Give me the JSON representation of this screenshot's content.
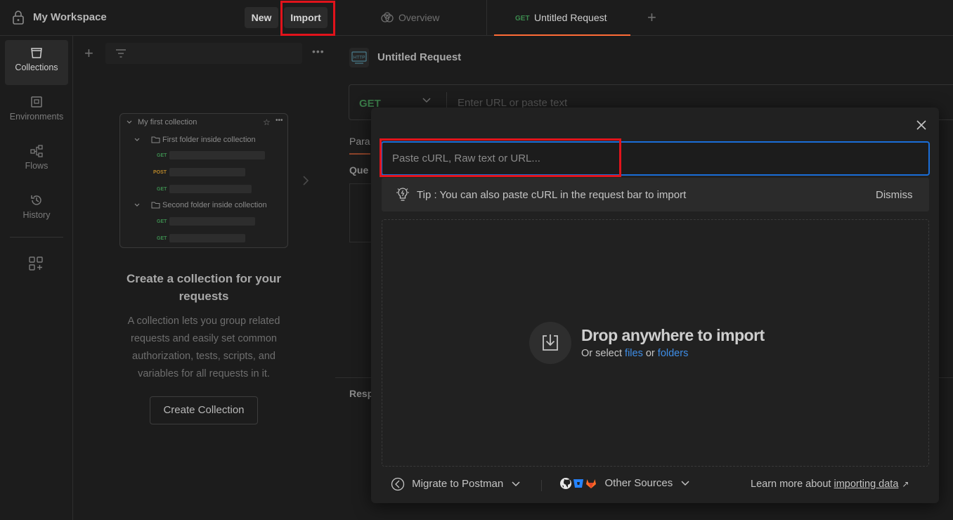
{
  "topbar": {
    "workspace_name": "My Workspace",
    "new_label": "New",
    "import_label": "Import",
    "tabs": [
      {
        "label": "Overview"
      },
      {
        "method": "GET",
        "label": "Untitled Request"
      }
    ]
  },
  "rail": {
    "items": [
      {
        "label": "Collections",
        "active": true
      },
      {
        "label": "Environments"
      },
      {
        "label": "Flows"
      },
      {
        "label": "History"
      }
    ]
  },
  "sidebar": {
    "preview": {
      "collection": "My first collection",
      "folder1": "First folder inside collection",
      "folder2": "Second folder inside collection",
      "methods": [
        "GET",
        "POST",
        "GET",
        "GET",
        "GET"
      ]
    },
    "empty_title": "Create a collection for your requests",
    "empty_desc": "A collection lets you group related requests and easily set common authorization, tests, scripts, and variables for all requests in it.",
    "create_label": "Create Collection"
  },
  "main": {
    "request_title": "Untitled Request",
    "method": "GET",
    "url_placeholder": "Enter URL or paste text",
    "params_label": "Para",
    "query_label": "Que",
    "response_label": "Resp"
  },
  "modal": {
    "input_placeholder": "Paste cURL, Raw text or URL...",
    "tip_text": "Tip : You can also paste cURL in the request bar to import",
    "dismiss_label": "Dismiss",
    "drop_title": "Drop anywhere to import",
    "drop_sub_prefix": "Or select ",
    "drop_files": "files",
    "drop_or": " or ",
    "drop_folders": "folders",
    "migrate_label": "Migrate to Postman",
    "other_label": "Other Sources",
    "learn_prefix": "Learn more about ",
    "learn_link": "importing data"
  },
  "colors": {
    "accent": "#ff6c37",
    "focus": "#1a6ed8",
    "highlight": "#e1131b",
    "link": "#3e8ee8",
    "get": "#3c8a4e",
    "post": "#b8862a"
  }
}
